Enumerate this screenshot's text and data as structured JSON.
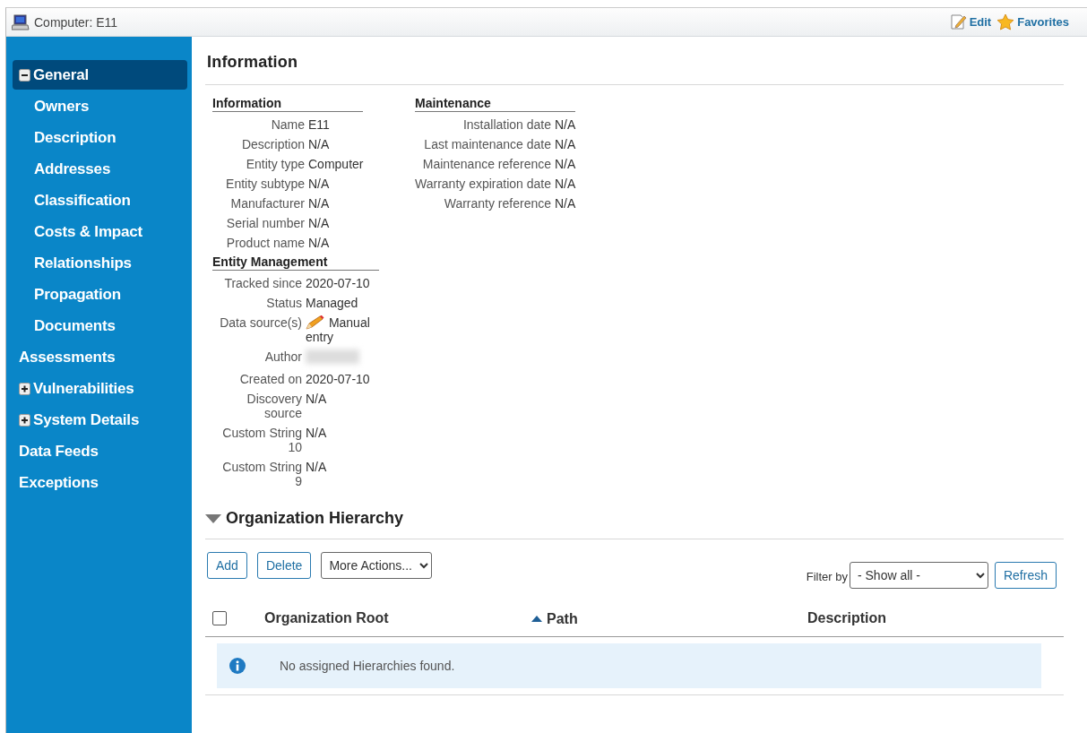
{
  "window": {
    "title": "Computer: E11",
    "actions": [
      {
        "label": "Edit",
        "kind": "edit"
      },
      {
        "label": "Favorites",
        "kind": "favorite"
      }
    ]
  },
  "sidebar": {
    "items": [
      {
        "label": "General",
        "kind": "group",
        "expanded": true,
        "selected": true,
        "children": [
          {
            "label": "Owners",
            "kind": "link",
            "selected": false
          },
          {
            "label": "Description",
            "kind": "link",
            "selected": false
          },
          {
            "label": "Addresses",
            "kind": "link",
            "selected": false
          },
          {
            "label": "Classification",
            "kind": "link",
            "selected": false
          },
          {
            "label": "Costs & Impact",
            "kind": "link",
            "selected": false
          },
          {
            "label": "Relationships",
            "kind": "link",
            "selected": false
          },
          {
            "label": "Propagation",
            "kind": "link",
            "selected": false
          },
          {
            "label": "Documents",
            "kind": "link",
            "selected": false
          }
        ]
      },
      {
        "label": "Assessments",
        "kind": "link",
        "selected": false
      },
      {
        "label": "Vulnerabilities",
        "kind": "group",
        "expanded": false,
        "selected": false
      },
      {
        "label": "System Details",
        "kind": "group",
        "expanded": false,
        "selected": false
      },
      {
        "label": "Data Feeds",
        "kind": "link",
        "selected": false
      },
      {
        "label": "Exceptions",
        "kind": "link",
        "selected": false
      }
    ]
  },
  "information": {
    "title": "Information",
    "columns": [
      [
        {
          "title": "Information",
          "fields": [
            {
              "label": "Name",
              "value": "E11",
              "kind": "text"
            },
            {
              "label": "Description",
              "value": "N/A",
              "kind": "text"
            },
            {
              "label": "Entity type",
              "value": "Computer",
              "kind": "text"
            },
            {
              "label": "Entity subtype",
              "value": "N/A",
              "kind": "text"
            },
            {
              "label": "Manufacturer",
              "value": "N/A",
              "kind": "text"
            },
            {
              "label": "Serial number",
              "value": "N/A",
              "kind": "text"
            },
            {
              "label": "Product name",
              "value": "N/A",
              "kind": "text"
            }
          ]
        },
        {
          "title": "Entity Management",
          "fields": [
            {
              "label": "Tracked since",
              "value": "2020-07-10",
              "kind": "text"
            },
            {
              "label": "Status",
              "value": "Managed",
              "kind": "text"
            },
            {
              "label": "Data source(s)",
              "value": "Manual entry",
              "kind": "source"
            },
            {
              "label": "Author",
              "kind": "redacted"
            },
            {
              "label": "Created on",
              "value": "2020-07-10",
              "kind": "text"
            },
            {
              "label": "Discovery source",
              "value": "N/A",
              "kind": "text"
            },
            {
              "label": "Custom String 10",
              "value": "N/A",
              "kind": "text"
            },
            {
              "label": "Custom String 9",
              "value": "N/A",
              "kind": "text"
            }
          ]
        }
      ],
      [
        {
          "title": "Maintenance",
          "fields": [
            {
              "label": "Installation date",
              "value": "N/A",
              "kind": "text"
            },
            {
              "label": "Last maintenance date",
              "value": "N/A",
              "kind": "text"
            },
            {
              "label": "Maintenance reference",
              "value": "N/A",
              "kind": "text"
            },
            {
              "label": "Warranty expiration date",
              "value": "N/A",
              "kind": "text"
            },
            {
              "label": "Warranty reference",
              "value": "N/A",
              "kind": "text"
            }
          ]
        }
      ]
    ]
  },
  "hierarchy": {
    "title": "Organization Hierarchy",
    "expanded": true,
    "buttons": [
      "Add",
      "Delete"
    ],
    "actions_menu": "More Actions...",
    "filter": {
      "label": "Filter by",
      "value": "- Show all -"
    },
    "refresh": "Refresh",
    "table": {
      "select_all_checked": false,
      "columns": [
        {
          "label": "Organization Root",
          "sorted": false
        },
        {
          "label": "Path",
          "sorted": true
        },
        {
          "label": "Description",
          "sorted": false
        }
      ],
      "empty_message": "No assigned Hierarchies found."
    }
  }
}
